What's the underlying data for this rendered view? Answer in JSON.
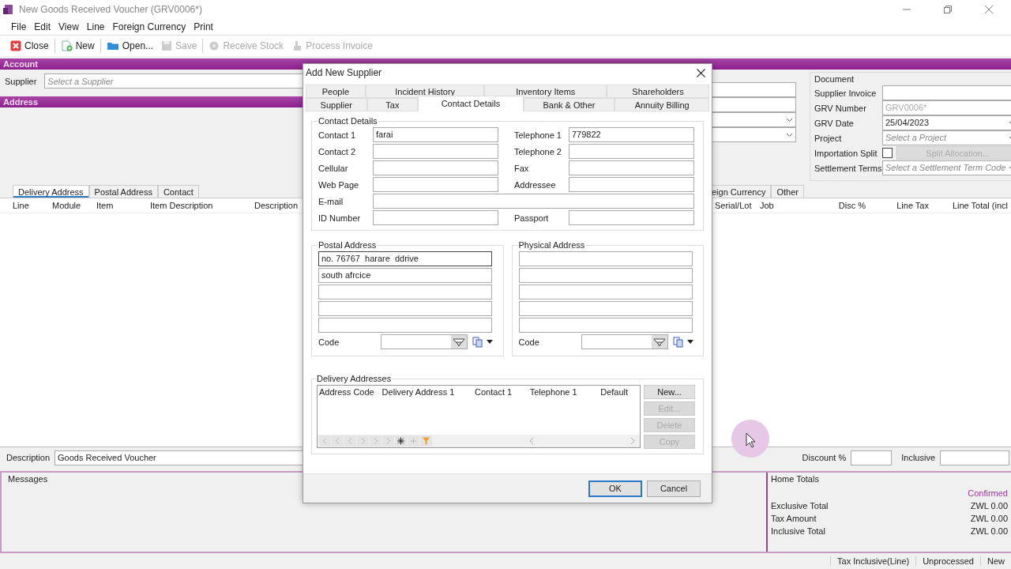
{
  "window": {
    "title": "New Goods Received Voucher (GRV0006*)"
  },
  "menu": [
    "File",
    "Edit",
    "View",
    "Line",
    "Foreign Currency",
    "Print"
  ],
  "toolbar": [
    {
      "label": "Close",
      "disabled": false
    },
    {
      "label": "New",
      "disabled": false
    },
    {
      "label": "Open...",
      "disabled": false
    },
    {
      "label": "Save",
      "disabled": true
    },
    {
      "label": "Receive Stock",
      "disabled": true
    },
    {
      "label": "Process Invoice",
      "disabled": true
    }
  ],
  "account": {
    "title": "Account",
    "supplier": {
      "label": "Supplier",
      "placeholder": "Select a Supplier"
    }
  },
  "middle_fields": [
    {
      "kind": "text"
    },
    {
      "kind": "text"
    },
    {
      "kind": "dropdown"
    },
    {
      "kind": "dropdown"
    }
  ],
  "document": {
    "title": "Document",
    "fields": [
      {
        "label": "Supplier Invoice",
        "kind": "text"
      },
      {
        "label": "GRV Number",
        "kind": "readonly",
        "value": "GRV0006*"
      },
      {
        "label": "GRV Date",
        "kind": "dropdown",
        "value": "25/04/2023"
      },
      {
        "label": "Project",
        "kind": "dropdown",
        "placeholder": "Select a Project"
      },
      {
        "label": "Importation Split",
        "kind": "checkbox",
        "checked": false,
        "button": {
          "label": "Split Allocation...",
          "disabled": true
        }
      },
      {
        "label": "Settlement Terms",
        "kind": "dropdown",
        "placeholder": "Select a Settlement Term Code"
      }
    ]
  },
  "address": {
    "title": "Address"
  },
  "address_tabs": [
    {
      "label": "Delivery Address",
      "selected": true
    },
    {
      "label": "Postal Address",
      "selected": false
    },
    {
      "label": "Contact",
      "selected": false
    }
  ],
  "right_tabs": [
    {
      "label": "eign Currency",
      "selected": false
    },
    {
      "label": "Other",
      "selected": false
    }
  ],
  "lines_table": {
    "columns_left": [
      "Line",
      "Module",
      "Item",
      "Item Description",
      "Description"
    ],
    "columns_right": [
      "Serial/Lot",
      "Job",
      "Disc %",
      "Line Tax",
      "Line Total (incl"
    ]
  },
  "footer": {
    "description": {
      "label": "Description",
      "value": "Goods Received Voucher"
    },
    "discount": {
      "label": "Discount %"
    },
    "inclusive": {
      "label": "Inclusive"
    }
  },
  "messages": {
    "title": "Messages"
  },
  "home_totals": {
    "title": "Home Totals",
    "status": "Confirmed",
    "rows": [
      {
        "label": "Exclusive Total",
        "value": "ZWL 0.00"
      },
      {
        "label": "Tax Amount",
        "value": "ZWL 0.00"
      },
      {
        "label": "Inclusive Total",
        "value": "ZWL 0.00"
      }
    ]
  },
  "status_bar": [
    "Tax Inclusive(Line)",
    "Unprocessed",
    "New"
  ],
  "dialog": {
    "title": "Add New Supplier",
    "tab_rows": [
      [
        {
          "label": "People",
          "selected": false
        },
        {
          "label": "Incident History",
          "selected": false
        },
        {
          "label": "Inventory Items",
          "selected": false
        },
        {
          "label": "Shareholders",
          "selected": false
        }
      ],
      [
        {
          "label": "Supplier",
          "selected": false
        },
        {
          "label": "Tax",
          "selected": false
        },
        {
          "label": "Contact Details",
          "selected": true
        },
        {
          "label": "Bank & Other",
          "selected": false
        },
        {
          "label": "Annuity Billing",
          "selected": false
        }
      ]
    ],
    "contact_details": {
      "title": "Contact Details",
      "fields": [
        {
          "label": "Contact 1",
          "kind": "half",
          "value": "farai"
        },
        {
          "label": "Telephone 1",
          "kind": "half",
          "value": "779822"
        },
        {
          "label": "Contact 2",
          "kind": "half"
        },
        {
          "label": "Telephone 2",
          "kind": "half"
        },
        {
          "label": "Cellular",
          "kind": "half"
        },
        {
          "label": "Fax",
          "kind": "half"
        },
        {
          "label": "Web Page",
          "kind": "half"
        },
        {
          "label": "Addressee",
          "kind": "half"
        },
        {
          "label": "E-mail",
          "kind": "wide"
        },
        {
          "label": "ID Number",
          "kind": "half"
        },
        {
          "label": "Passport",
          "kind": "half"
        }
      ]
    },
    "addresses": [
      {
        "title": "Postal Address",
        "lines": [
          {
            "kind": "line",
            "value": "no. 76767  harare  ddrive",
            "focused": true
          },
          {
            "kind": "line",
            "value": "south afrcice",
            "focused": false
          },
          {
            "kind": "line",
            "focused": false
          },
          {
            "kind": "line",
            "focused": false
          },
          {
            "kind": "line",
            "focused": false
          }
        ],
        "code": {
          "label": "Code"
        }
      },
      {
        "title": "Physical Address",
        "lines": [
          {
            "kind": "line",
            "focused": false
          },
          {
            "kind": "line",
            "focused": false
          },
          {
            "kind": "line",
            "focused": false
          },
          {
            "kind": "line",
            "focused": false
          },
          {
            "kind": "line",
            "focused": false
          }
        ],
        "code": {
          "label": "Code"
        }
      }
    ],
    "delivery": {
      "title": "Delivery Addresses",
      "columns": [
        "Address Code",
        "Delivery Address 1",
        "Contact 1",
        "Telephone 1",
        "Default"
      ],
      "buttons": [
        {
          "label": "New...",
          "disabled": false
        },
        {
          "label": "Edit...",
          "disabled": true
        },
        {
          "label": "Delete",
          "disabled": true
        },
        {
          "label": "Copy",
          "disabled": true
        }
      ]
    },
    "buttons": [
      {
        "label": "OK",
        "default": true
      },
      {
        "label": "Cancel",
        "default": false
      }
    ]
  }
}
